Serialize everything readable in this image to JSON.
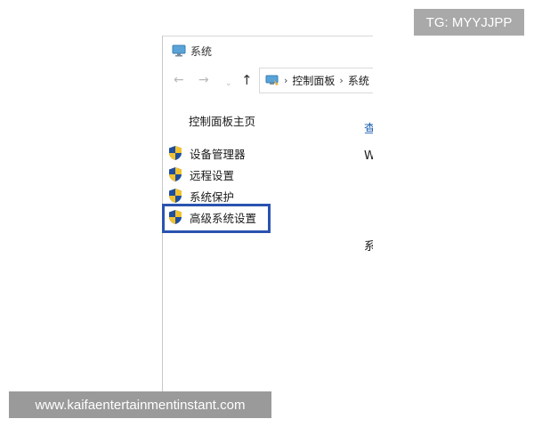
{
  "watermark_top": "TG: MYYJJPP",
  "watermark_bottom": "www.kaifaentertainmentinstant.com",
  "window": {
    "title": "系统",
    "nav": {
      "back_icon": "←",
      "forward_icon": "→",
      "recent_icon": "⌄",
      "up_icon": "↑"
    },
    "address": {
      "separator": "›",
      "crumbs": [
        "控制面板",
        "系统"
      ]
    }
  },
  "sidebar": {
    "home": "控制面板主页",
    "items": [
      {
        "label": "设备管理器",
        "icon": "shield-icon"
      },
      {
        "label": "远程设置",
        "icon": "shield-icon"
      },
      {
        "label": "系统保护",
        "icon": "shield-icon"
      },
      {
        "label": "高级系统设置",
        "icon": "shield-icon"
      }
    ]
  },
  "main_fragments": {
    "heading": "查",
    "line1": "W",
    "line2": "系"
  },
  "colors": {
    "highlight": "#2a53b0",
    "link": "#1a5fb4"
  }
}
